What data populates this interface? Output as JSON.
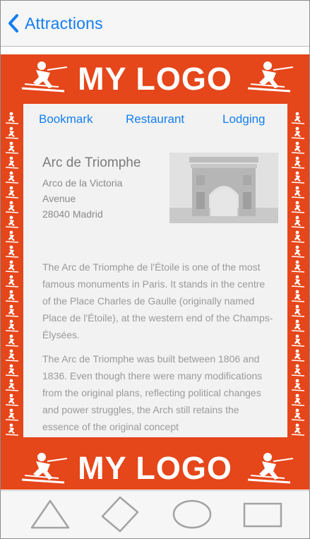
{
  "navbar": {
    "back_label": "Attractions"
  },
  "logo": {
    "top_text": "MY LOGO",
    "bottom_text": "MY LOGO"
  },
  "tabs": [
    "Bookmark",
    "Restaurant",
    "Lodging"
  ],
  "attraction": {
    "title": "Arc de Triomphe",
    "address_lines": [
      "Arco de la Victoria",
      "Avenue",
      "28040 Madrid"
    ],
    "photo_icon": "arc-de-triomphe-photo"
  },
  "description": [
    "The Arc de Triomphe de l'Étoile is one of the most famous monuments in Paris. It stands in the centre of the Place Charles de Gaulle (originally named Place de l'Étoile), at the western end of the Champs-Élysées.",
    "The Arc de Triomphe was built between 1806 and 1836. Even though there were many modifications from the original plans, reflecting political changes and power struggles, the Arch still retains the essence of the original concept"
  ],
  "toolbar": {
    "icons": [
      "triangle-icon",
      "diamond-icon",
      "ellipse-icon",
      "rectangle-icon"
    ]
  },
  "colors": {
    "accent": "#147ef0",
    "frame": "#e5461a",
    "bar": "#f6f6f6",
    "toolbar_icon": "#a3a3a3"
  }
}
